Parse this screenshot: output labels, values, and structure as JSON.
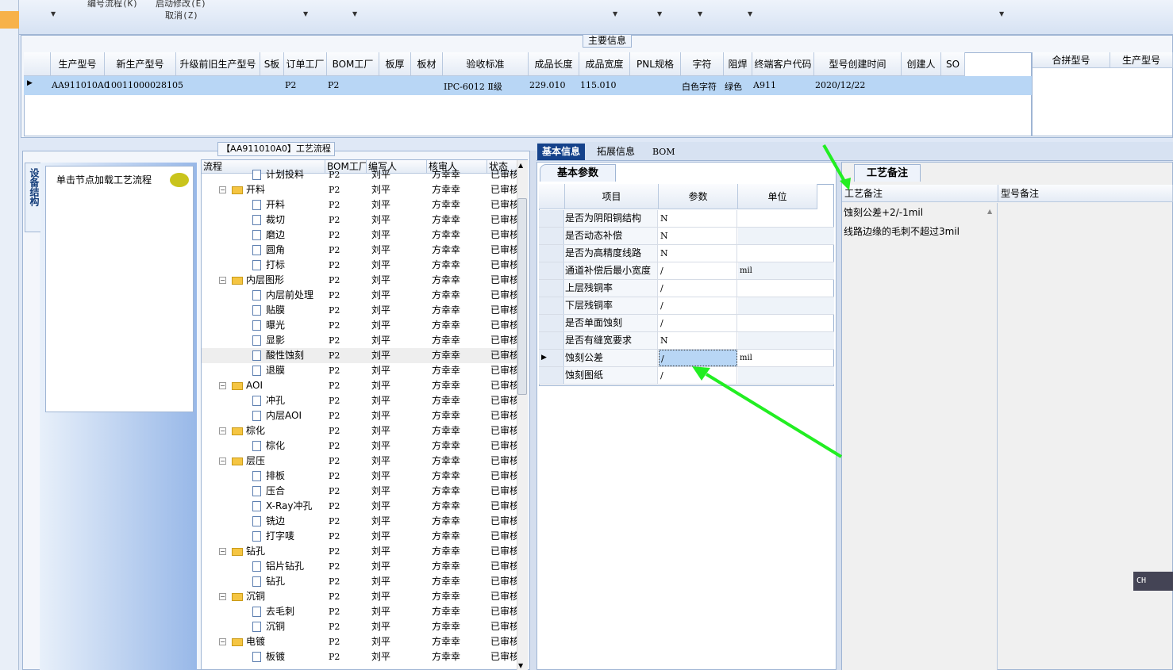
{
  "toolbar": {
    "item1": "编号流程(K)",
    "item2": "启动修改(E)",
    "item3": "取消(Z)"
  },
  "main_info": {
    "caption": "主要信息",
    "columns": [
      "生产型号",
      "新生产型号",
      "升级前旧生产型号",
      "S板",
      "订单工厂",
      "BOM工厂",
      "板厚",
      "板材",
      "验收标准",
      "成品长度",
      "成品宽度",
      "PNL规格",
      "字符",
      "阻焊",
      "终端客户代码",
      "型号创建时间",
      "创建人",
      "SO"
    ],
    "row": {
      "c0": "AA911010A0",
      "c1": "10011000028105",
      "c2": "",
      "c3": "",
      "c4": "P2",
      "c5": "P2",
      "c6": "",
      "c7": "",
      "c8": "IPC-6012 Ⅱ级",
      "c9": "229.010",
      "c10": "115.010",
      "c11": "",
      "c12": "白色字符",
      "c13": "绿色",
      "c14": "A911",
      "c15": "2020/12/22",
      "c16": "",
      "c17": ""
    },
    "right_columns": [
      "合拼型号",
      "生产型号"
    ]
  },
  "left": {
    "vtab": "设备结构",
    "click_hint": "单击节点加载工艺流程"
  },
  "flow": {
    "caption": "【AA911010A0】工艺流程",
    "headers": [
      "流程",
      "BOM工厂",
      "编写人",
      "核审人",
      "状态"
    ],
    "rows": [
      {
        "name": "计划投料",
        "bom": "P2",
        "editor": "刘平",
        "checker": "方幸幸",
        "status": "已审核",
        "type": "doc"
      },
      {
        "name": "开料",
        "bom": "P2",
        "editor": "刘平",
        "checker": "方幸幸",
        "status": "已审核",
        "type": "folder"
      },
      {
        "name": "开料",
        "bom": "P2",
        "editor": "刘平",
        "checker": "方幸幸",
        "status": "已审核",
        "type": "doc"
      },
      {
        "name": "裁切",
        "bom": "P2",
        "editor": "刘平",
        "checker": "方幸幸",
        "status": "已审核",
        "type": "doc"
      },
      {
        "name": "磨边",
        "bom": "P2",
        "editor": "刘平",
        "checker": "方幸幸",
        "status": "已审核",
        "type": "doc"
      },
      {
        "name": "圆角",
        "bom": "P2",
        "editor": "刘平",
        "checker": "方幸幸",
        "status": "已审核",
        "type": "doc"
      },
      {
        "name": "打标",
        "bom": "P2",
        "editor": "刘平",
        "checker": "方幸幸",
        "status": "已审核",
        "type": "doc"
      },
      {
        "name": "内层图形",
        "bom": "P2",
        "editor": "刘平",
        "checker": "方幸幸",
        "status": "已审核",
        "type": "folder"
      },
      {
        "name": "内层前处理",
        "bom": "P2",
        "editor": "刘平",
        "checker": "方幸幸",
        "status": "已审核",
        "type": "doc"
      },
      {
        "name": "贴膜",
        "bom": "P2",
        "editor": "刘平",
        "checker": "方幸幸",
        "status": "已审核",
        "type": "doc"
      },
      {
        "name": "曝光",
        "bom": "P2",
        "editor": "刘平",
        "checker": "方幸幸",
        "status": "已审核",
        "type": "doc"
      },
      {
        "name": "显影",
        "bom": "P2",
        "editor": "刘平",
        "checker": "方幸幸",
        "status": "已审核",
        "type": "doc"
      },
      {
        "name": "酸性蚀刻",
        "bom": "P2",
        "editor": "刘平",
        "checker": "方幸幸",
        "status": "已审核",
        "type": "doc"
      },
      {
        "name": "退膜",
        "bom": "P2",
        "editor": "刘平",
        "checker": "方幸幸",
        "status": "已审核",
        "type": "doc"
      },
      {
        "name": "AOI",
        "bom": "P2",
        "editor": "刘平",
        "checker": "方幸幸",
        "status": "已审核",
        "type": "folder"
      },
      {
        "name": "冲孔",
        "bom": "P2",
        "editor": "刘平",
        "checker": "方幸幸",
        "status": "已审核",
        "type": "doc"
      },
      {
        "name": "内层AOI",
        "bom": "P2",
        "editor": "刘平",
        "checker": "方幸幸",
        "status": "已审核",
        "type": "doc"
      },
      {
        "name": "棕化",
        "bom": "P2",
        "editor": "刘平",
        "checker": "方幸幸",
        "status": "已审核",
        "type": "folder"
      },
      {
        "name": "棕化",
        "bom": "P2",
        "editor": "刘平",
        "checker": "方幸幸",
        "status": "已审核",
        "type": "doc"
      },
      {
        "name": "层压",
        "bom": "P2",
        "editor": "刘平",
        "checker": "方幸幸",
        "status": "已审核",
        "type": "folder"
      },
      {
        "name": "排板",
        "bom": "P2",
        "editor": "刘平",
        "checker": "方幸幸",
        "status": "已审核",
        "type": "doc"
      },
      {
        "name": "压合",
        "bom": "P2",
        "editor": "刘平",
        "checker": "方幸幸",
        "status": "已审核",
        "type": "doc"
      },
      {
        "name": "X-Ray冲孔",
        "bom": "P2",
        "editor": "刘平",
        "checker": "方幸幸",
        "status": "已审核",
        "type": "doc"
      },
      {
        "name": "铣边",
        "bom": "P2",
        "editor": "刘平",
        "checker": "方幸幸",
        "status": "已审核",
        "type": "doc"
      },
      {
        "name": "打字唛",
        "bom": "P2",
        "editor": "刘平",
        "checker": "方幸幸",
        "status": "已审核",
        "type": "doc"
      },
      {
        "name": "钻孔",
        "bom": "P2",
        "editor": "刘平",
        "checker": "方幸幸",
        "status": "已审核",
        "type": "folder"
      },
      {
        "name": "铝片钻孔",
        "bom": "P2",
        "editor": "刘平",
        "checker": "方幸幸",
        "status": "已审核",
        "type": "doc"
      },
      {
        "name": "钻孔",
        "bom": "P2",
        "editor": "刘平",
        "checker": "方幸幸",
        "status": "已审核",
        "type": "doc"
      },
      {
        "name": "沉铜",
        "bom": "P2",
        "editor": "刘平",
        "checker": "方幸幸",
        "status": "已审核",
        "type": "folder"
      },
      {
        "name": "去毛刺",
        "bom": "P2",
        "editor": "刘平",
        "checker": "方幸幸",
        "status": "已审核",
        "type": "doc"
      },
      {
        "name": "沉铜",
        "bom": "P2",
        "editor": "刘平",
        "checker": "方幸幸",
        "status": "已审核",
        "type": "doc"
      },
      {
        "name": "电镀",
        "bom": "P2",
        "editor": "刘平",
        "checker": "方幸幸",
        "status": "已审核",
        "type": "folder"
      },
      {
        "name": "板镀",
        "bom": "P2",
        "editor": "刘平",
        "checker": "方幸幸",
        "status": "已审核",
        "type": "doc"
      }
    ]
  },
  "tabs": {
    "basic": "基本信息",
    "ext": "拓展信息",
    "bom": "BOM"
  },
  "params": {
    "subtab": "基本参数",
    "headers": {
      "item": "项目",
      "param": "参数",
      "unit": "单位"
    },
    "rows": [
      {
        "item": "是否为阴阳铜结构",
        "value": "N",
        "unit": ""
      },
      {
        "item": "是否动态补偿",
        "value": "N",
        "unit": ""
      },
      {
        "item": "是否为高精度线路",
        "value": "N",
        "unit": ""
      },
      {
        "item": "通道补偿后最小宽度",
        "value": "/",
        "unit": "mil"
      },
      {
        "item": "上层残铜率",
        "value": "/",
        "unit": ""
      },
      {
        "item": "下层残铜率",
        "value": "/",
        "unit": ""
      },
      {
        "item": "是否单面蚀刻",
        "value": "/",
        "unit": ""
      },
      {
        "item": "是否有缝宽要求",
        "value": "N",
        "unit": ""
      },
      {
        "item": "蚀刻公差",
        "value": "/",
        "unit": "mil"
      },
      {
        "item": "蚀刻图纸",
        "value": "/",
        "unit": ""
      }
    ]
  },
  "remarks": {
    "tab": "工艺备注",
    "col1": "工艺备注",
    "col2": "型号备注",
    "lines": [
      "蚀刻公差+2/-1mil",
      "线路边缘的毛刺不超过3mil"
    ]
  },
  "ime": {
    "label": "CH"
  },
  "colors": {
    "accent": "#15428b",
    "selection": "#b8d6f5",
    "annotation_arrow": "#22ee22"
  }
}
